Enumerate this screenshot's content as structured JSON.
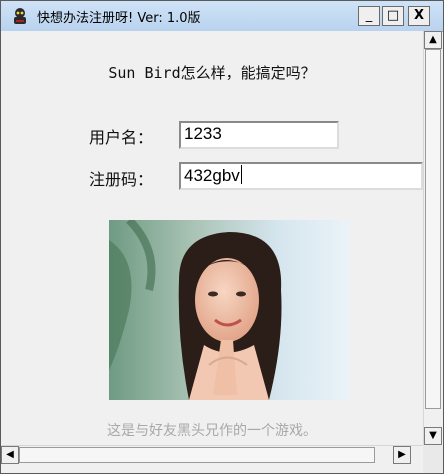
{
  "window": {
    "title": "快想办法注册呀!   Ver: 1.0版",
    "buttons": {
      "minimize": "_",
      "maximize": "□",
      "close": "X"
    }
  },
  "main": {
    "question": "Sun Bird怎么样，能搞定吗？",
    "username_label": "用户名：",
    "username_value": "1233",
    "regcode_label": "注册码：",
    "regcode_value": "432gbv",
    "footer": "这是与好友黑头兄作的一个游戏。"
  },
  "scrollbars": {
    "up": "▲",
    "down": "▼",
    "left": "◀",
    "right": "▶"
  },
  "icons": {
    "app": "app-icon",
    "photo": "portrait-photo"
  }
}
